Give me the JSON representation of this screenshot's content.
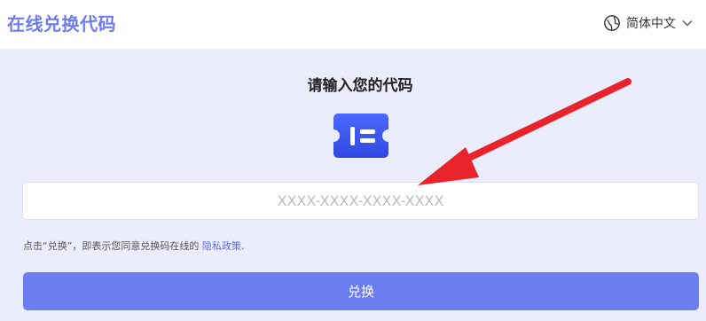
{
  "header": {
    "brand": "在线兑换代码",
    "language": {
      "label": "简体中文",
      "icon": "globe-icon",
      "chevron": "chevron-down-icon"
    }
  },
  "main": {
    "heading": "请输入您的代码",
    "ticket_icon": "ticket-icon",
    "code_input": {
      "placeholder": "XXXX-XXXX-XXXX-XXXX",
      "value": ""
    },
    "consent": {
      "text": "点击“兑换”，即表示您同意兑换码在线的 ",
      "link": "隐私政策",
      "suffix": "."
    },
    "redeem_button": "兑换"
  },
  "colors": {
    "accent": "#6b7ef1",
    "background": "#ebedfd",
    "ticket_icon": "#3b57f0",
    "annotation_arrow": "#e8232a"
  }
}
